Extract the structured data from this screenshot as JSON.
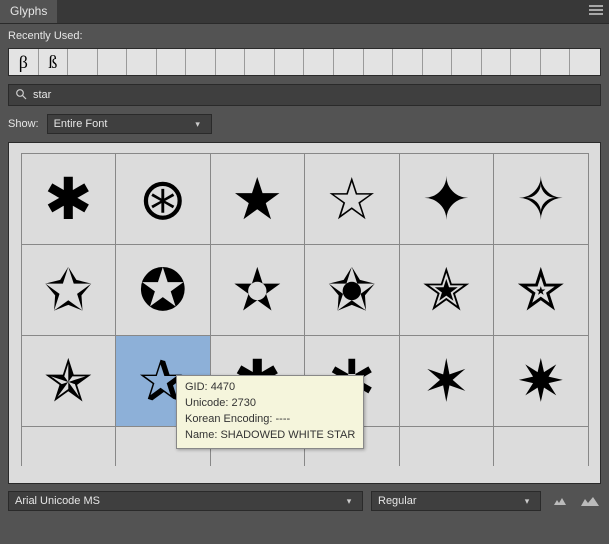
{
  "panel": {
    "title": "Glyphs"
  },
  "recent": {
    "label": "Recently Used:",
    "items": [
      "β",
      "ß"
    ]
  },
  "search": {
    "value": "star"
  },
  "show": {
    "label": "Show:",
    "value": "Entire Font"
  },
  "glyphs": [
    "✱",
    "⊛",
    "★",
    "☆",
    "✦",
    "✧",
    "✩",
    "✪",
    "✫",
    "✬",
    "✭",
    "✮",
    "✯",
    "✰",
    "✱",
    "✲",
    "✶",
    "✷"
  ],
  "selected_index": 13,
  "tooltip": {
    "gid_label": "GID:",
    "gid": "4470",
    "unicode_label": "Unicode:",
    "unicode": "2730",
    "encoding_label": "Korean Encoding:",
    "encoding": "----",
    "name_label": "Name:",
    "name": "SHADOWED WHITE STAR"
  },
  "font": {
    "name": "Arial Unicode MS",
    "style": "Regular"
  }
}
